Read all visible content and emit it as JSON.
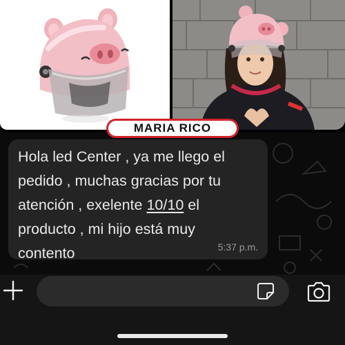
{
  "customer": {
    "name": "MARIA RICO"
  },
  "message": {
    "line1": "Hola led Center , ya me llego el",
    "line2": "pedido , muchas gracias por tu",
    "line3_before": "atención , exelente ",
    "rating": "10/10",
    "line3_after": " el",
    "line4": "producto , mi hijo está muy",
    "line5": "contento",
    "time": "5:37 p.m."
  },
  "colors": {
    "badge_border": "#d2232a",
    "bubble_bg": "#242424",
    "chat_bg": "#0b0b0b",
    "helmet_pink": "#f2bfc6",
    "input_bg": "#2b2b2b"
  },
  "icons": {
    "attach": "plus-icon",
    "sticker": "sticker-icon",
    "camera": "camera-icon"
  }
}
